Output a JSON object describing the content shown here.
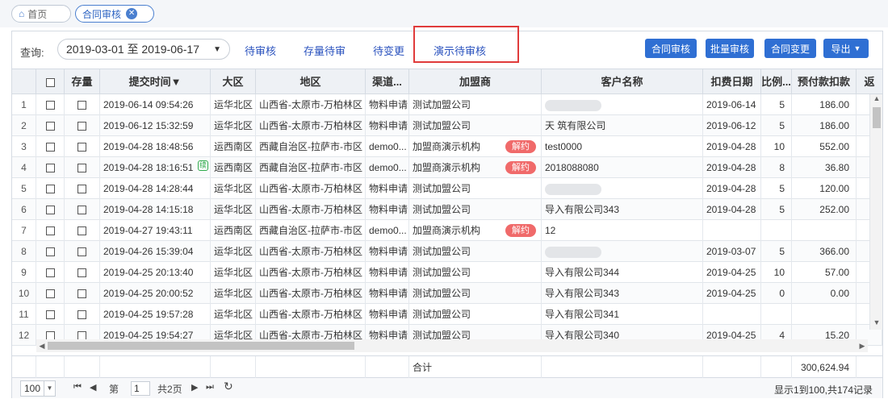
{
  "tabs": [
    {
      "label": "首页",
      "icon": "home-icon"
    },
    {
      "label": "合同审核",
      "icon": "close-icon"
    }
  ],
  "toolbar": {
    "query_label": "查询:",
    "date_range": "2019-03-01 至 2019-06-17",
    "quick_links": [
      "待审核",
      "存量待审",
      "待变更",
      "演示待审核"
    ],
    "buttons": [
      "合同审核",
      "批量审核",
      "合同变更",
      "导出"
    ]
  },
  "columns": [
    "",
    "存量",
    "提交时间▼",
    "大区",
    "地区",
    "渠道...",
    "加盟商",
    "客户名称",
    "扣费日期",
    "比例...",
    "预付款扣款",
    "返"
  ],
  "rows": [
    {
      "idx": "1",
      "time": "2019-06-14 09:54:26",
      "region": "运华北区",
      "area": "山西省-太原市-万柏林区",
      "channel": "物料申请",
      "franchise": "测试加盟公司",
      "tag": "",
      "customer": "",
      "date": "2019-06-14",
      "ratio": "5",
      "amount": "186.00",
      "green": false
    },
    {
      "idx": "2",
      "time": "2019-06-12 15:32:59",
      "region": "运华北区",
      "area": "山西省-太原市-万柏林区",
      "channel": "物料申请",
      "franchise": "测试加盟公司",
      "tag": "",
      "customer": "天 筑有限公司",
      "date": "2019-06-12",
      "ratio": "5",
      "amount": "186.00",
      "green": false
    },
    {
      "idx": "3",
      "time": "2019-04-28 18:48:56",
      "region": "运西南区",
      "area": "西藏自治区-拉萨市-市区",
      "channel": "demo0...",
      "franchise": "加盟商演示机构",
      "tag": "解约",
      "customer": "test0000",
      "date": "2019-04-28",
      "ratio": "10",
      "amount": "552.00",
      "green": false
    },
    {
      "idx": "4",
      "time": "2019-04-28 18:16:51",
      "region": "运西南区",
      "area": "西藏自治区-拉萨市-市区",
      "channel": "demo0...",
      "franchise": "加盟商演示机构",
      "tag": "解约",
      "customer": "2018088080",
      "date": "2019-04-28",
      "ratio": "8",
      "amount": "36.80",
      "green": true
    },
    {
      "idx": "5",
      "time": "2019-04-28 14:28:44",
      "region": "运华北区",
      "area": "山西省-太原市-万柏林区",
      "channel": "物料申请",
      "franchise": "测试加盟公司",
      "tag": "",
      "customer": "",
      "date": "2019-04-28",
      "ratio": "5",
      "amount": "120.00",
      "green": false
    },
    {
      "idx": "6",
      "time": "2019-04-28 14:15:18",
      "region": "运华北区",
      "area": "山西省-太原市-万柏林区",
      "channel": "物料申请",
      "franchise": "测试加盟公司",
      "tag": "",
      "customer": "导入有限公司343",
      "date": "2019-04-28",
      "ratio": "5",
      "amount": "252.00",
      "green": false
    },
    {
      "idx": "7",
      "time": "2019-04-27 19:43:11",
      "region": "运西南区",
      "area": "西藏自治区-拉萨市-市区",
      "channel": "demo0...",
      "franchise": "加盟商演示机构",
      "tag": "解约",
      "customer": "12",
      "date": "",
      "ratio": "",
      "amount": "",
      "green": false
    },
    {
      "idx": "8",
      "time": "2019-04-26 15:39:04",
      "region": "运华北区",
      "area": "山西省-太原市-万柏林区",
      "channel": "物料申请",
      "franchise": "测试加盟公司",
      "tag": "",
      "customer": "",
      "date": "2019-03-07",
      "ratio": "5",
      "amount": "366.00",
      "green": false
    },
    {
      "idx": "9",
      "time": "2019-04-25 20:13:40",
      "region": "运华北区",
      "area": "山西省-太原市-万柏林区",
      "channel": "物料申请",
      "franchise": "测试加盟公司",
      "tag": "",
      "customer": "导入有限公司344",
      "date": "2019-04-25",
      "ratio": "10",
      "amount": "57.00",
      "green": false
    },
    {
      "idx": "10",
      "time": "2019-04-25 20:00:52",
      "region": "运华北区",
      "area": "山西省-太原市-万柏林区",
      "channel": "物料申请",
      "franchise": "测试加盟公司",
      "tag": "",
      "customer": "导入有限公司343",
      "date": "2019-04-25",
      "ratio": "0",
      "amount": "0.00",
      "green": false
    },
    {
      "idx": "11",
      "time": "2019-04-25 19:57:28",
      "region": "运华北区",
      "area": "山西省-太原市-万柏林区",
      "channel": "物料申请",
      "franchise": "测试加盟公司",
      "tag": "",
      "customer": "导入有限公司341",
      "date": "",
      "ratio": "",
      "amount": "",
      "green": false
    },
    {
      "idx": "12",
      "time": "2019-04-25 19:54:27",
      "region": "运华北区",
      "area": "山西省-太原市-万柏林区",
      "channel": "物料申请",
      "franchise": "测试加盟公司",
      "tag": "",
      "customer": "导入有限公司340",
      "date": "2019-04-25",
      "ratio": "4",
      "amount": "15.20",
      "green": false
    }
  ],
  "summary": {
    "label": "合计",
    "amount": "300,624.94"
  },
  "pager": {
    "page_size": "100",
    "page_prefix": "第",
    "page_value": "1",
    "page_suffix": "共2页",
    "info": "显示1到100,共174记录"
  }
}
